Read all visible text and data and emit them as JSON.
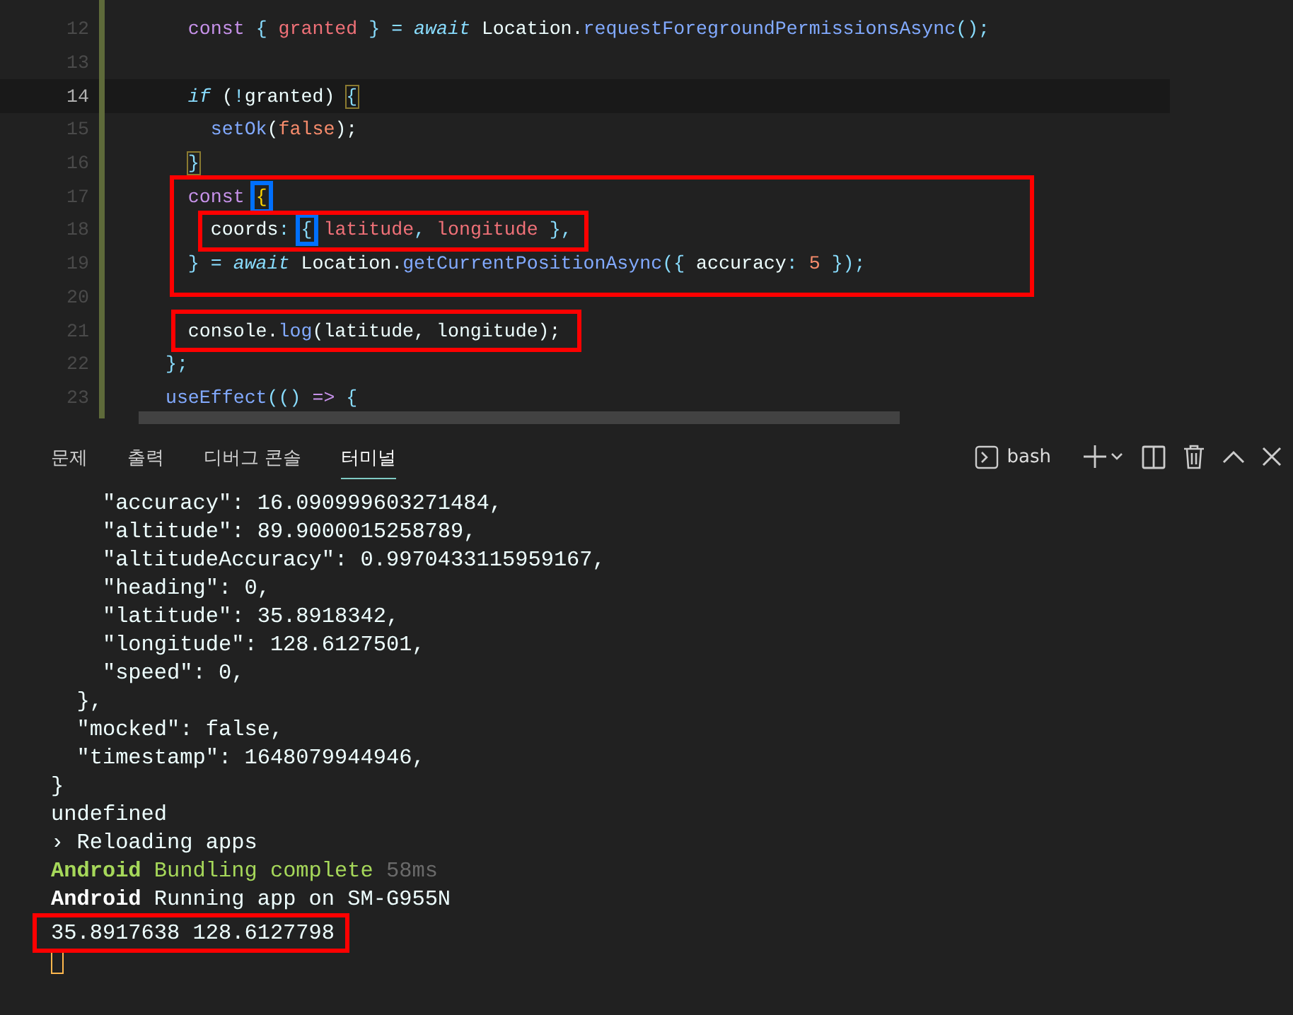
{
  "editor": {
    "lines": [
      {
        "number": "12",
        "current": false,
        "tokens": [
          {
            "kind": "keyword",
            "text": "    const"
          },
          {
            "kind": "punct",
            "text": " { "
          },
          {
            "kind": "variable",
            "text": "granted"
          },
          {
            "kind": "punct",
            "text": " } = "
          },
          {
            "kind": "await",
            "text": "await"
          },
          {
            "kind": "plain",
            "text": " Location."
          },
          {
            "kind": "function",
            "text": "requestForegroundPermissionsAsync"
          },
          {
            "kind": "punct",
            "text": "();"
          }
        ]
      },
      {
        "number": "13",
        "current": false
      },
      {
        "number": "14",
        "current": true,
        "tokens": [
          {
            "kind": "await",
            "text": "    if"
          },
          {
            "kind": "plain",
            "text": " ("
          },
          {
            "kind": "punct",
            "text": "!"
          },
          {
            "kind": "plain",
            "text": "granted) "
          },
          {
            "kind": "match",
            "text": "{"
          }
        ]
      },
      {
        "number": "15",
        "current": false,
        "tokens": [
          {
            "kind": "function",
            "text": "      setOk"
          },
          {
            "kind": "plain",
            "text": "("
          },
          {
            "kind": "number",
            "text": "false"
          },
          {
            "kind": "plain",
            "text": ");"
          }
        ]
      },
      {
        "number": "16",
        "current": false,
        "tokens": [
          {
            "kind": "match",
            "text": "    }"
          }
        ]
      },
      {
        "number": "17",
        "current": false,
        "tokens": [
          {
            "kind": "keyword",
            "text": "    const "
          },
          {
            "kind": "bracket-marked",
            "text": "{"
          }
        ]
      },
      {
        "number": "18",
        "current": false,
        "tokens": [
          {
            "kind": "plain",
            "text": "      coords"
          },
          {
            "kind": "punct",
            "text": ": "
          },
          {
            "kind": "punct-marked",
            "text": "{"
          },
          {
            "kind": "variable",
            "text": " latitude"
          },
          {
            "kind": "punct",
            "text": ", "
          },
          {
            "kind": "variable",
            "text": "longitude"
          },
          {
            "kind": "punct",
            "text": " },"
          }
        ]
      },
      {
        "number": "19",
        "current": false,
        "tokens": [
          {
            "kind": "punct",
            "text": "    } = "
          },
          {
            "kind": "await",
            "text": "await"
          },
          {
            "kind": "plain",
            "text": " Location."
          },
          {
            "kind": "function",
            "text": "getCurrentPositionAsync"
          },
          {
            "kind": "punct",
            "text": "({ "
          },
          {
            "kind": "plain",
            "text": "accuracy"
          },
          {
            "kind": "punct",
            "text": ": "
          },
          {
            "kind": "number",
            "text": "5"
          },
          {
            "kind": "punct",
            "text": " });"
          }
        ]
      },
      {
        "number": "20",
        "current": false
      },
      {
        "number": "21",
        "current": false,
        "tokens": [
          {
            "kind": "plain",
            "text": "    console."
          },
          {
            "kind": "function",
            "text": "log"
          },
          {
            "kind": "plain",
            "text": "(latitude, longitude);"
          }
        ]
      },
      {
        "number": "22",
        "current": false,
        "tokens": [
          {
            "kind": "punct",
            "text": "  };"
          }
        ]
      },
      {
        "number": "23",
        "current": false,
        "tokens": [
          {
            "kind": "function",
            "text": "  useEffect"
          },
          {
            "kind": "punct",
            "text": "(() "
          },
          {
            "kind": "keyword",
            "text": "=>"
          },
          {
            "kind": "punct",
            "text": " {"
          }
        ]
      }
    ]
  },
  "panel": {
    "tabs": [
      {
        "label": "문제",
        "selected": false
      },
      {
        "label": "출력",
        "selected": false
      },
      {
        "label": "디버그 콘솔",
        "selected": false
      },
      {
        "label": "터미널",
        "selected": true
      }
    ],
    "shell": "bash",
    "terminal": [
      {
        "tokens": [
          {
            "kind": "plain",
            "text": "    \"accuracy\": 16.090999603271484,"
          }
        ]
      },
      {
        "tokens": [
          {
            "kind": "plain",
            "text": "    \"altitude\": 89.9000015258789,"
          }
        ]
      },
      {
        "tokens": [
          {
            "kind": "plain",
            "text": "    \"altitudeAccuracy\": 0.9970433115959167,"
          }
        ]
      },
      {
        "tokens": [
          {
            "kind": "plain",
            "text": "    \"heading\": 0,"
          }
        ]
      },
      {
        "tokens": [
          {
            "kind": "plain",
            "text": "    \"latitude\": 35.8918342,"
          }
        ]
      },
      {
        "tokens": [
          {
            "kind": "plain",
            "text": "    \"longitude\": 128.6127501,"
          }
        ]
      },
      {
        "tokens": [
          {
            "kind": "plain",
            "text": "    \"speed\": 0,"
          }
        ]
      },
      {
        "tokens": [
          {
            "kind": "plain",
            "text": "  },"
          }
        ]
      },
      {
        "tokens": [
          {
            "kind": "plain",
            "text": "  \"mocked\": false,"
          }
        ]
      },
      {
        "tokens": [
          {
            "kind": "plain",
            "text": "  \"timestamp\": 1648079944946,"
          }
        ]
      },
      {
        "tokens": [
          {
            "kind": "plain",
            "text": "}"
          }
        ]
      },
      {
        "tokens": [
          {
            "kind": "plain",
            "text": "undefined"
          }
        ]
      },
      {
        "tokens": [
          {
            "kind": "plain",
            "text": "› Reloading apps"
          }
        ]
      },
      {
        "tokens": [
          {
            "kind": "green-bold",
            "text": "Android"
          },
          {
            "kind": "green",
            "text": " Bundling complete"
          },
          {
            "kind": "dim",
            "text": " 58ms"
          }
        ]
      },
      {
        "tokens": [
          {
            "kind": "bold",
            "text": "Android"
          },
          {
            "kind": "plain",
            "text": " Running app on SM-G955N"
          }
        ]
      },
      {
        "boxed": true,
        "tokens": [
          {
            "kind": "plain",
            "text": "35.8917638 128.6127798"
          }
        ]
      }
    ]
  }
}
